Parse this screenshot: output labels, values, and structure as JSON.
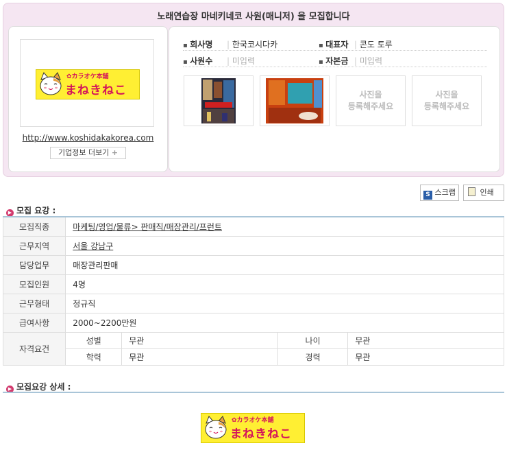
{
  "header": {
    "title": "노래연습장 마네키네코 사원(매니저) 을 모집합니다"
  },
  "company": {
    "url": "http://www.koshidakakorea.com",
    "more_label": "기업정보 더보기",
    "more_icon": "+",
    "logo": {
      "sub": "✿カラオケ本舗",
      "main": "まねきねこ"
    },
    "fields": [
      {
        "label": "회사명",
        "value": "한국코시다카"
      },
      {
        "label": "대표자",
        "value": "콘도 토루"
      },
      {
        "label": "사원수",
        "value": "미입력"
      },
      {
        "label": "자본금",
        "value": "미입력"
      }
    ],
    "photo_placeholder": "사진을\n등록해주세요"
  },
  "actions": {
    "scrap": "스크랩",
    "print": "인쇄"
  },
  "recruit": {
    "title": "모집 요강 :",
    "rows": [
      {
        "label": "모집직종",
        "value": "마케팅/영업/물류> 판매직/매장관리/프런트"
      },
      {
        "label": "근무지역",
        "value": "서울 강남구"
      },
      {
        "label": "담당업무",
        "value": "매장관리판매"
      },
      {
        "label": "모집인원",
        "value": "4명"
      },
      {
        "label": "근무형태",
        "value": "정규직"
      },
      {
        "label": "급여사항",
        "value": "2000~2200만원"
      }
    ],
    "qual": {
      "label": "자격요건",
      "items": [
        {
          "label": "성별",
          "value": "무관"
        },
        {
          "label": "나이",
          "value": "무관"
        },
        {
          "label": "학력",
          "value": "무관"
        },
        {
          "label": "경력",
          "value": "무관"
        }
      ]
    }
  },
  "detail": {
    "title": "모집요강 상세 :"
  },
  "colors": {
    "accent": "#d23a6e",
    "panel_bg": "#f5e6f2",
    "table_top": "#a9c5d8"
  }
}
